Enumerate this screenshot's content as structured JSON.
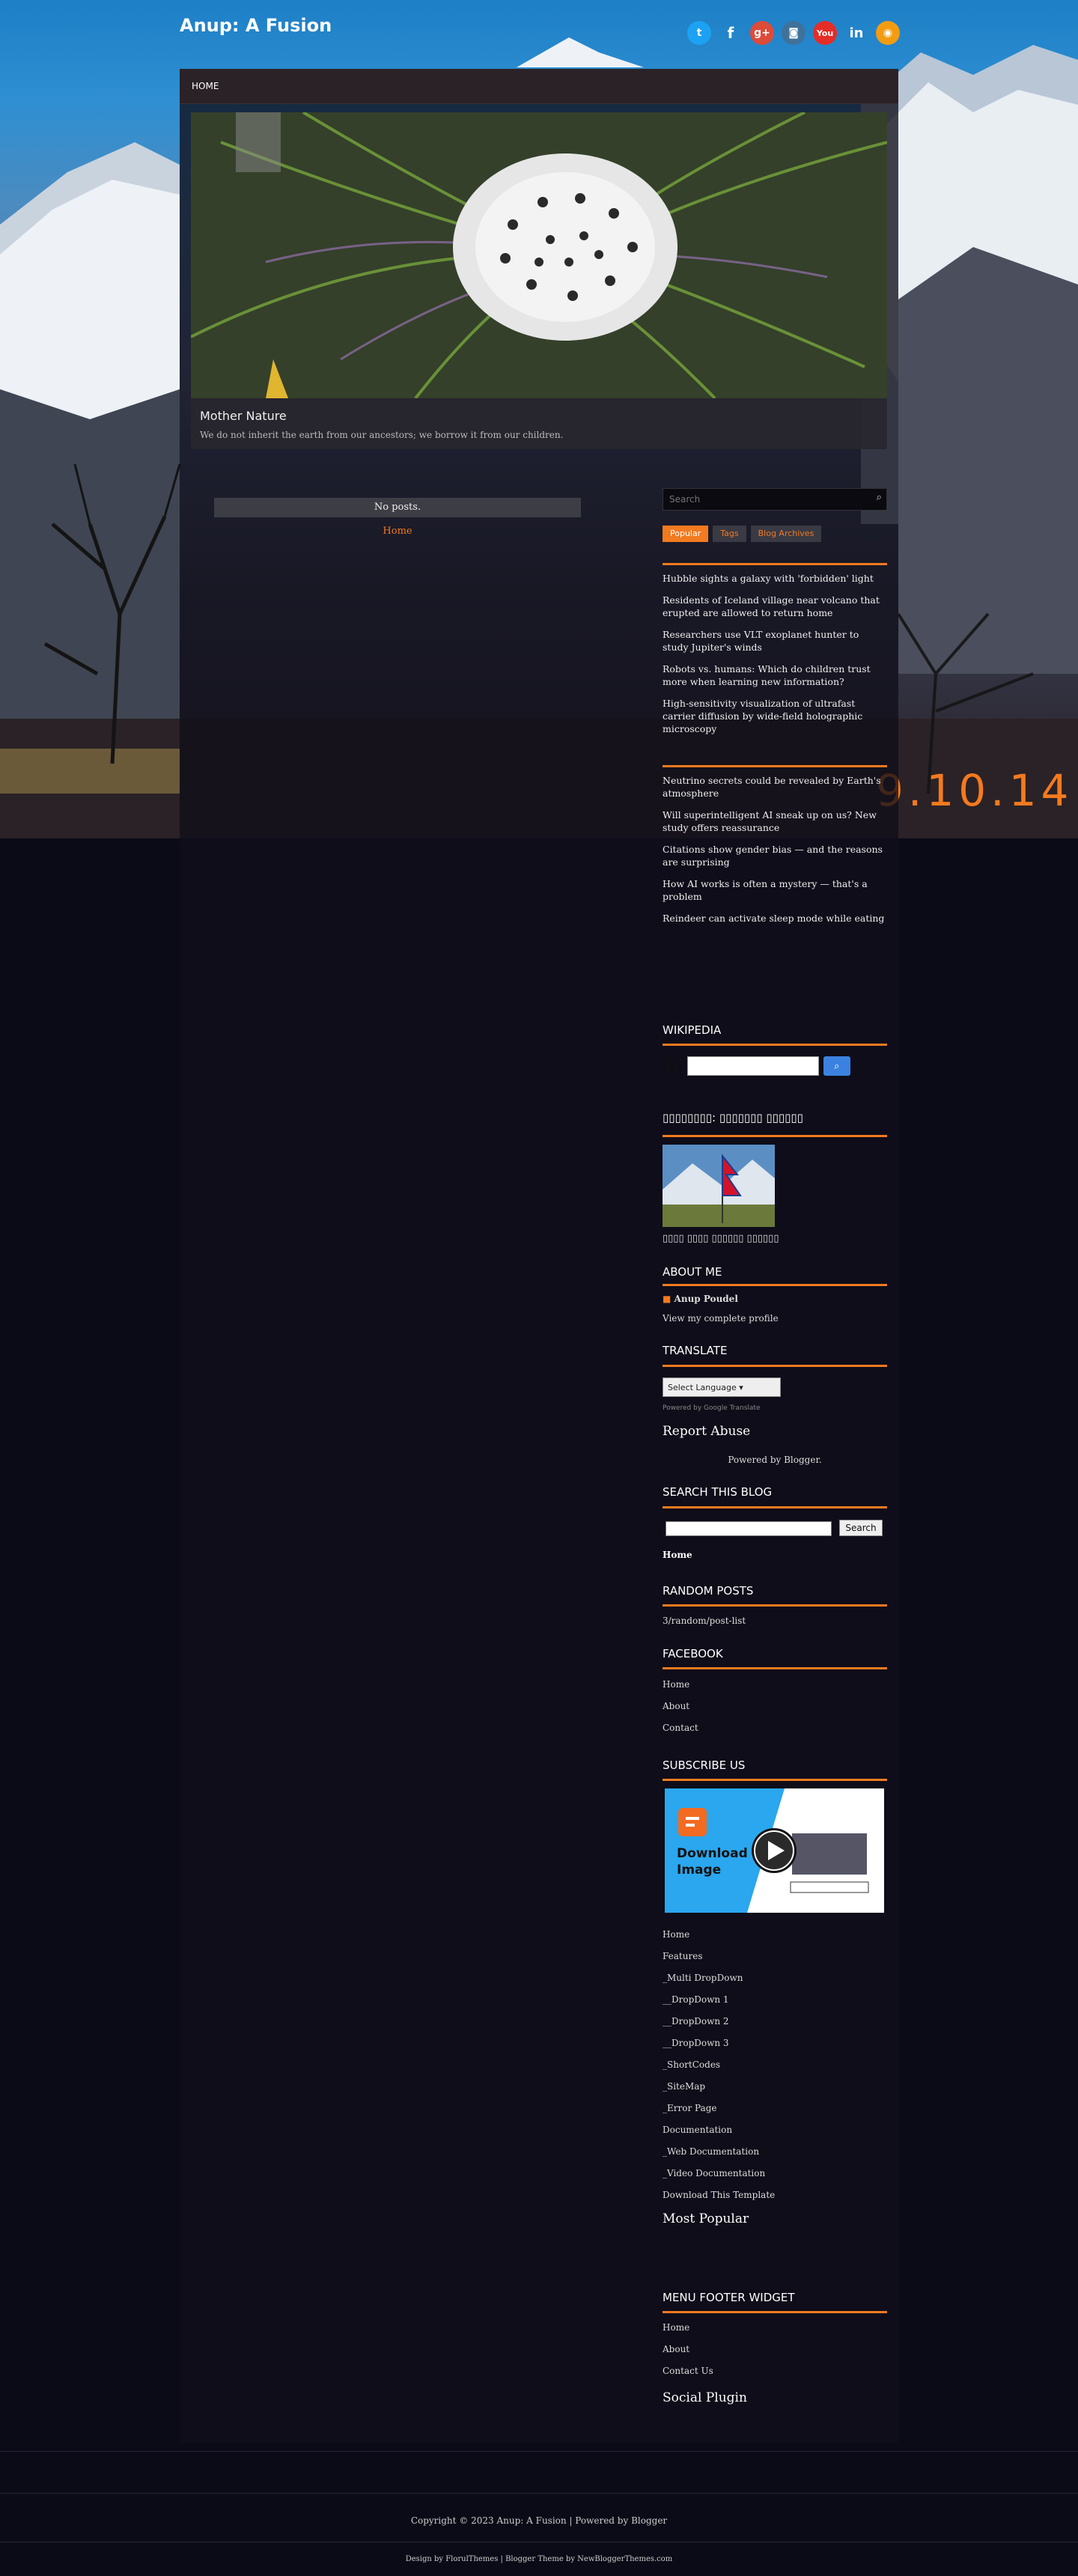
{
  "site": {
    "title": "Anup: A Fusion"
  },
  "social_icons": [
    "twitter-icon",
    "facebook-icon",
    "google-plus-icon",
    "instagram-icon",
    "youtube-icon",
    "linkedin-icon",
    "rss-icon"
  ],
  "nav": {
    "home": "HOME"
  },
  "slider": {
    "title": "Mother Nature",
    "text": "We do not inherit the earth from our ancestors; we borrow it from our children."
  },
  "backdrop_stamp": "9.10.14",
  "main": {
    "no_posts": "No posts.",
    "home_link": "Home"
  },
  "sidebar": {
    "search_placeholder": "Search",
    "tabs": [
      "Popular",
      "Tags",
      "Blog Archives"
    ],
    "feed1": [
      "Hubble sights a galaxy with 'forbidden' light",
      "Residents of Iceland village near volcano that erupted are allowed to return home",
      "Researchers use VLT exoplanet hunter to study Jupiter's winds",
      "Robots vs. humans: Which do children trust more when learning new information?",
      "High-sensitivity visualization of ultrafast carrier diffusion by wide-field holographic microscopy"
    ],
    "feed2": [
      "Neutrino secrets could be revealed by Earth's atmosphere",
      "Will superintelligent AI sneak up on us? New study offers reassurance",
      "Citations show gender bias — and the reasons are surprising",
      "How AI works is often a mystery — that's a problem",
      "Reindeer can activate sleep mode while eating"
    ],
    "wikipedia_title": "WIKIPEDIA",
    "nepal_title": "▯▯▯▯▯▯▯▯: ▯▯▯▯▯▯▯ ▯▯▯▯▯▯",
    "nepal_caption": "▯▯▯▯ ▯▯▯▯ ▯▯▯▯▯▯ ▯▯▯▯▯▯",
    "about_title": "ABOUT ME",
    "about_name": "Anup Poudel",
    "about_profile": "View my complete profile",
    "translate_title": "TRANSLATE",
    "translate_select": "Select Language",
    "translate_powered": "Powered by Google Translate",
    "report_abuse": "Report Abuse",
    "powered_blogger": "Powered by Blogger.",
    "search_blog_title": "SEARCH THIS BLOG",
    "search_button": "Search",
    "search_home": "Home",
    "random_title": "RANDOM POSTS",
    "random_text": "3/random/post-list",
    "facebook_title": "FACEBOOK",
    "facebook_links": [
      "Home",
      "About",
      "Contact"
    ],
    "subscribe_title": "SUBSCRIBE US",
    "subscribe_img_text": "Download Image",
    "menu_links": [
      "Home",
      "Features",
      "_Multi DropDown",
      "__DropDown 1",
      "__DropDown 2",
      "__DropDown 3",
      "_ShortCodes",
      "_SiteMap",
      "_Error Page",
      "Documentation",
      "_Web Documentation",
      "_Video Documentation",
      "Download This Template"
    ],
    "most_popular": "Most Popular",
    "menu_footer_title": "MENU FOOTER WIDGET",
    "menu_footer_links": [
      "Home",
      "About",
      "Contact Us"
    ],
    "social_plugin": "Social Plugin"
  },
  "footer": {
    "copyright": "Copyright © 2023 Anup: A Fusion | Powered by Blogger",
    "design": "Design by FlorulThemes | Blogger Theme by NewBloggerThemes.com"
  },
  "colors": {
    "accent": "#f27a1f",
    "page_bg": "#0b0b18"
  }
}
